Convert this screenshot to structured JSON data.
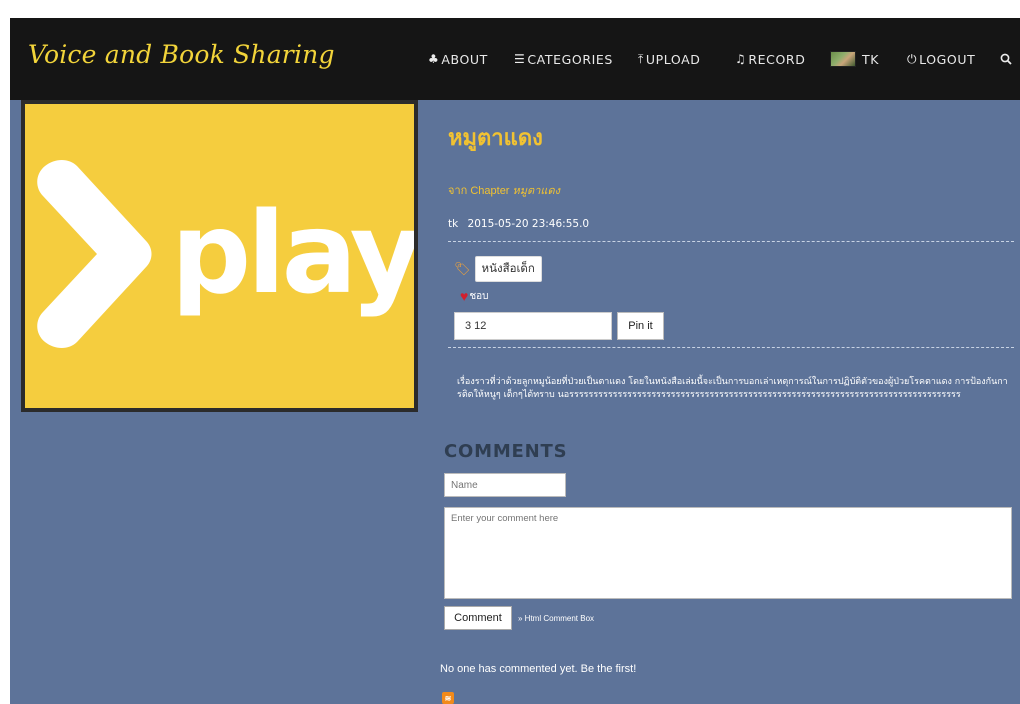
{
  "brand": {
    "title": "Voice and Book Sharing"
  },
  "nav": {
    "about": "ABOUT",
    "categories": "CATEGORIES",
    "upload": "UPLOAD",
    "record": "RECORD",
    "user": "TK",
    "logout": "LOGOUT"
  },
  "media": {
    "logo_text": "play"
  },
  "post": {
    "title": "หมูตาแดง",
    "chapter_prefix": "จาก Chapter",
    "chapter_name": "หมูตาแดง",
    "author": "tk",
    "datetime": "2015-05-20 23:46:55.0",
    "tag": "หนังสือเด็ก",
    "like_label": "ชอบ",
    "pin_value": "3 12",
    "pin_button": "Pin it",
    "description": "เรื่องราวที่ว่าด้วยลูกหมูน้อยที่ป่วยเป็นตาแดง โดยในหนังสือเล่มนี้จะเป็นการบอกเล่าเหตุการณ์ในการปฏิบัติตัวของผู้ป่วยโรคตาแดง การป้องกันการติดให้หนูๆ เด็กๆได้ทราบ นอรรรรรรรรรรรรรรรรรรรรรรรรรรรรรรรรรรรรรรรรรรรรรรรรรรรรรรรรรรรรรรรรรรรรรรรรรรรรรรรรร"
  },
  "comments": {
    "heading": "COMMENTS",
    "name_placeholder": "Name",
    "comment_placeholder": "Enter your comment here",
    "submit": "Comment",
    "powered": "Html Comment Box",
    "empty_text": "No one has commented yet. Be the first!"
  },
  "colors": {
    "page_bg": "#5d7399",
    "topbar_bg": "#151515",
    "accent_yellow": "#f1c232",
    "play_card": "#f5cd3e"
  }
}
